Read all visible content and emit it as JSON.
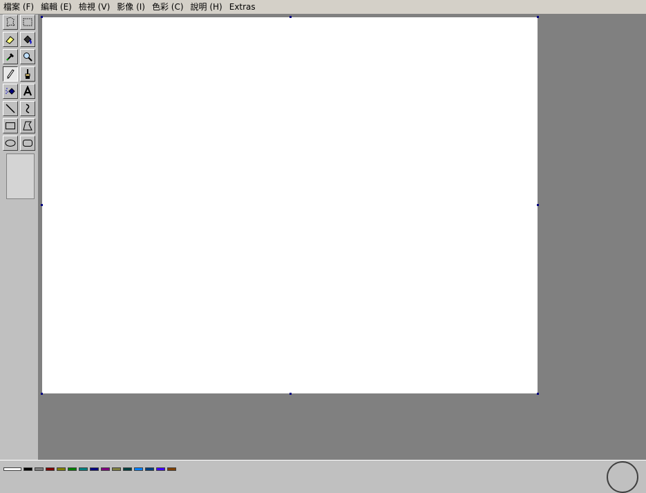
{
  "menubar": {
    "items": [
      {
        "label": "檔案 (F)"
      },
      {
        "label": "編輯 (E)"
      },
      {
        "label": "檢視 (V)"
      },
      {
        "label": "影像 (I)"
      },
      {
        "label": "色彩 (C)"
      },
      {
        "label": "說明 (H)"
      },
      {
        "label": "Extras"
      }
    ]
  },
  "toolbox": {
    "selected_tool": "pencil",
    "tools": [
      "free-form-select",
      "rect-select",
      "eraser",
      "fill",
      "color-picker",
      "magnifier",
      "pencil",
      "brush",
      "airbrush",
      "text",
      "line",
      "curve",
      "rectangle",
      "polygon",
      "ellipse",
      "rounded-rectangle"
    ]
  },
  "colors": {
    "workspace_bg": "#808080",
    "canvas_bg": "#ffffff",
    "chrome": "#c0c0c0",
    "handle": "#000080"
  }
}
